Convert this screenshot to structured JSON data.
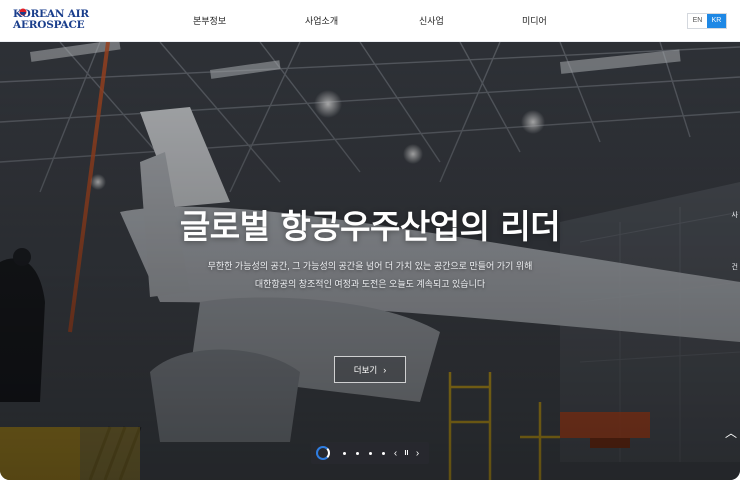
{
  "header": {
    "logo_line1": "KOREAN AIR",
    "logo_line2": "AEROSPACE",
    "nav": [
      "본부정보",
      "사업소개",
      "신사업",
      "미디어"
    ],
    "lang_en": "EN",
    "lang_kr": "KR",
    "active_lang": "KR"
  },
  "hero": {
    "title": "글로벌 항공우주산업의 리더",
    "desc_line1": "무한한 가능성의 공간, 그 가능성의 공간을 넘어 더 가치 있는 공간으로 만들어 가기 위해",
    "desc_line2": "대한항공의 창조적인 여정과 도전은 오늘도 계속되고 있습니다",
    "more_label": "더보기",
    "more_chevron": "›",
    "side_text_top": "사",
    "side_text_mid": "건"
  },
  "slider": {
    "dots": 4,
    "prev": "‹",
    "pause": "II",
    "next": "›"
  },
  "colors": {
    "brand": "#1a3e8c",
    "accent": "#1e88e5"
  },
  "icons": {
    "scroll_top": "chevron-up-icon"
  }
}
